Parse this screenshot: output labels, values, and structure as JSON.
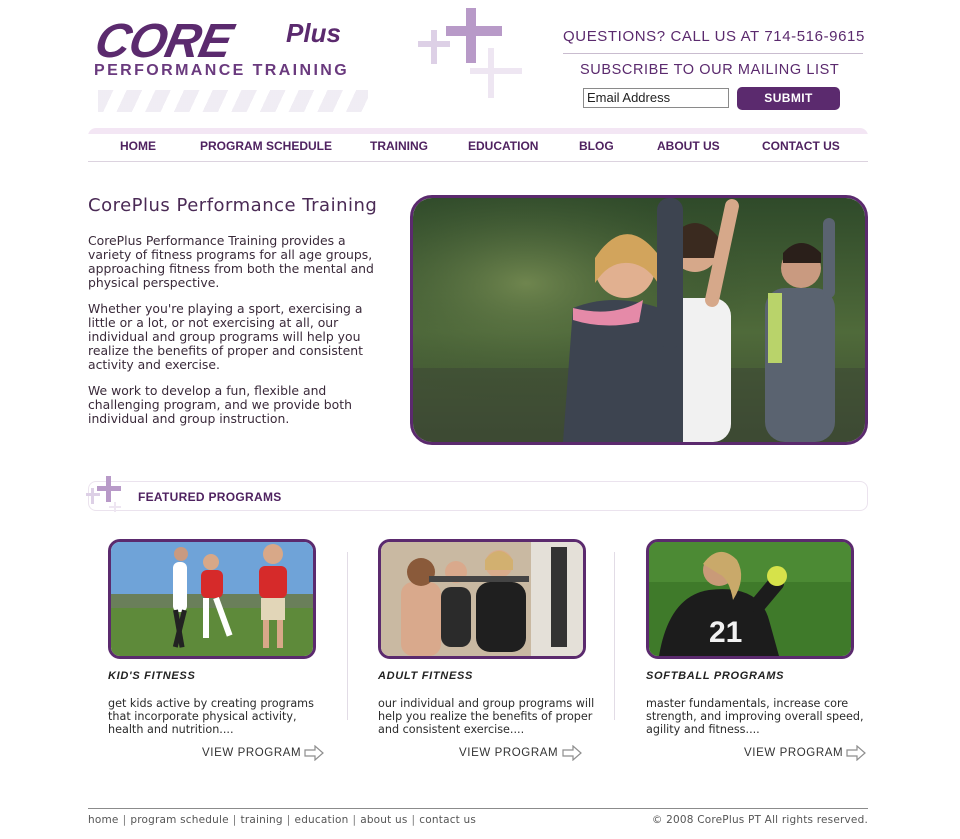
{
  "header": {
    "logo_main": "CORE",
    "logo_plus": "Plus",
    "logo_sub": "PERFORMANCE TRAINING",
    "phone_text": "QUESTIONS? CALL US AT 714-516-9615",
    "subscribe_text": "SUBSCRIBE TO OUR MAILING LIST",
    "email_placeholder": "Email Address",
    "submit_label": "SUBMIT"
  },
  "nav": {
    "items": [
      {
        "label": "HOME"
      },
      {
        "label": "PROGRAM SCHEDULE"
      },
      {
        "label": "TRAINING"
      },
      {
        "label": "EDUCATION"
      },
      {
        "label": "BLOG"
      },
      {
        "label": "ABOUT US"
      },
      {
        "label": "CONTACT US"
      }
    ]
  },
  "intro": {
    "title": "CorePlus Performance Training",
    "paragraphs": [
      "CorePlus Performance Training provides a variety of fitness programs for all age groups, approaching fitness from both the mental and physical perspective.",
      "Whether you're playing a sport, exercising a little or a lot, or not exercising at all, our individual and group programs will help you realize the benefits of proper and consistent activity and exercise.",
      "We work to develop a fun, flexible and challenging program, and we provide both individual and group instruction."
    ]
  },
  "featured": {
    "title": "FEATURED PROGRAMS",
    "programs": [
      {
        "title": "KID'S FITNESS",
        "description": "get kids active by creating programs that incorporate physical activity, health and nutrition....",
        "link": "VIEW PROGRAM"
      },
      {
        "title": "ADULT FITNESS",
        "description": "our individual and group programs will help you realize the benefits of proper and consistent exercise....",
        "link": "VIEW PROGRAM"
      },
      {
        "title": "SOFTBALL PROGRAMS",
        "description": "master fundamentals, increase core strength, and improving overall speed, agility and fitness....",
        "link": "VIEW PROGRAM"
      }
    ]
  },
  "footer": {
    "links": [
      "home",
      "program schedule",
      "training",
      "education",
      "about us",
      "contact us"
    ],
    "copyright": "© 2008 CorePlus PT All rights reserved."
  },
  "colors": {
    "brand_purple": "#5b2a6e",
    "nav_text": "#4f2260",
    "light_lilac": "#d9c6e6"
  }
}
